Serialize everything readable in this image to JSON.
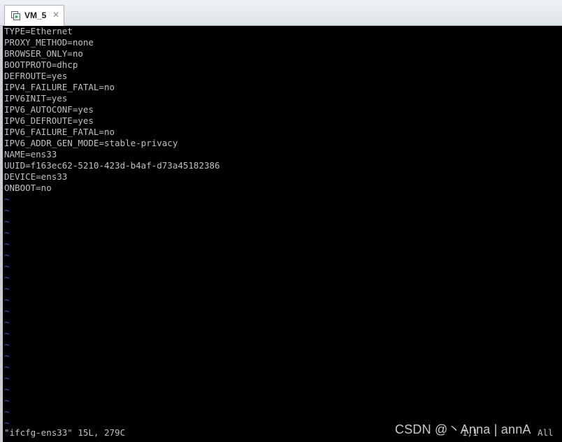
{
  "window": {
    "tab_label": "VM_5",
    "tab_icon": "vm-console-icon",
    "close_icon": "close-icon"
  },
  "editor": {
    "lines": [
      "TYPE=Ethernet",
      "PROXY_METHOD=none",
      "BROWSER_ONLY=no",
      "BOOTPROTO=dhcp",
      "DEFROUTE=yes",
      "IPV4_FAILURE_FATAL=no",
      "IPV6INIT=yes",
      "IPV6_AUTOCONF=yes",
      "IPV6_DEFROUTE=yes",
      "IPV6_FAILURE_FATAL=no",
      "IPV6_ADDR_GEN_MODE=stable-privacy",
      "NAME=ens33",
      "UUID=f163ec62-5210-423d-b4af-d73a45182386",
      "DEVICE=ens33",
      "ONBOOT=no"
    ],
    "empty_marker": "~",
    "empty_marker_count": 21,
    "status_message": "\"ifcfg-ens33\" 15L, 279C",
    "cursor_position": "1,1",
    "scroll_indicator": "All"
  },
  "watermark": "CSDN @丶Anna | annA",
  "colors": {
    "console_bg": "#000000",
    "text": "#c0c0c0",
    "tilde": "#3b5bd6"
  }
}
